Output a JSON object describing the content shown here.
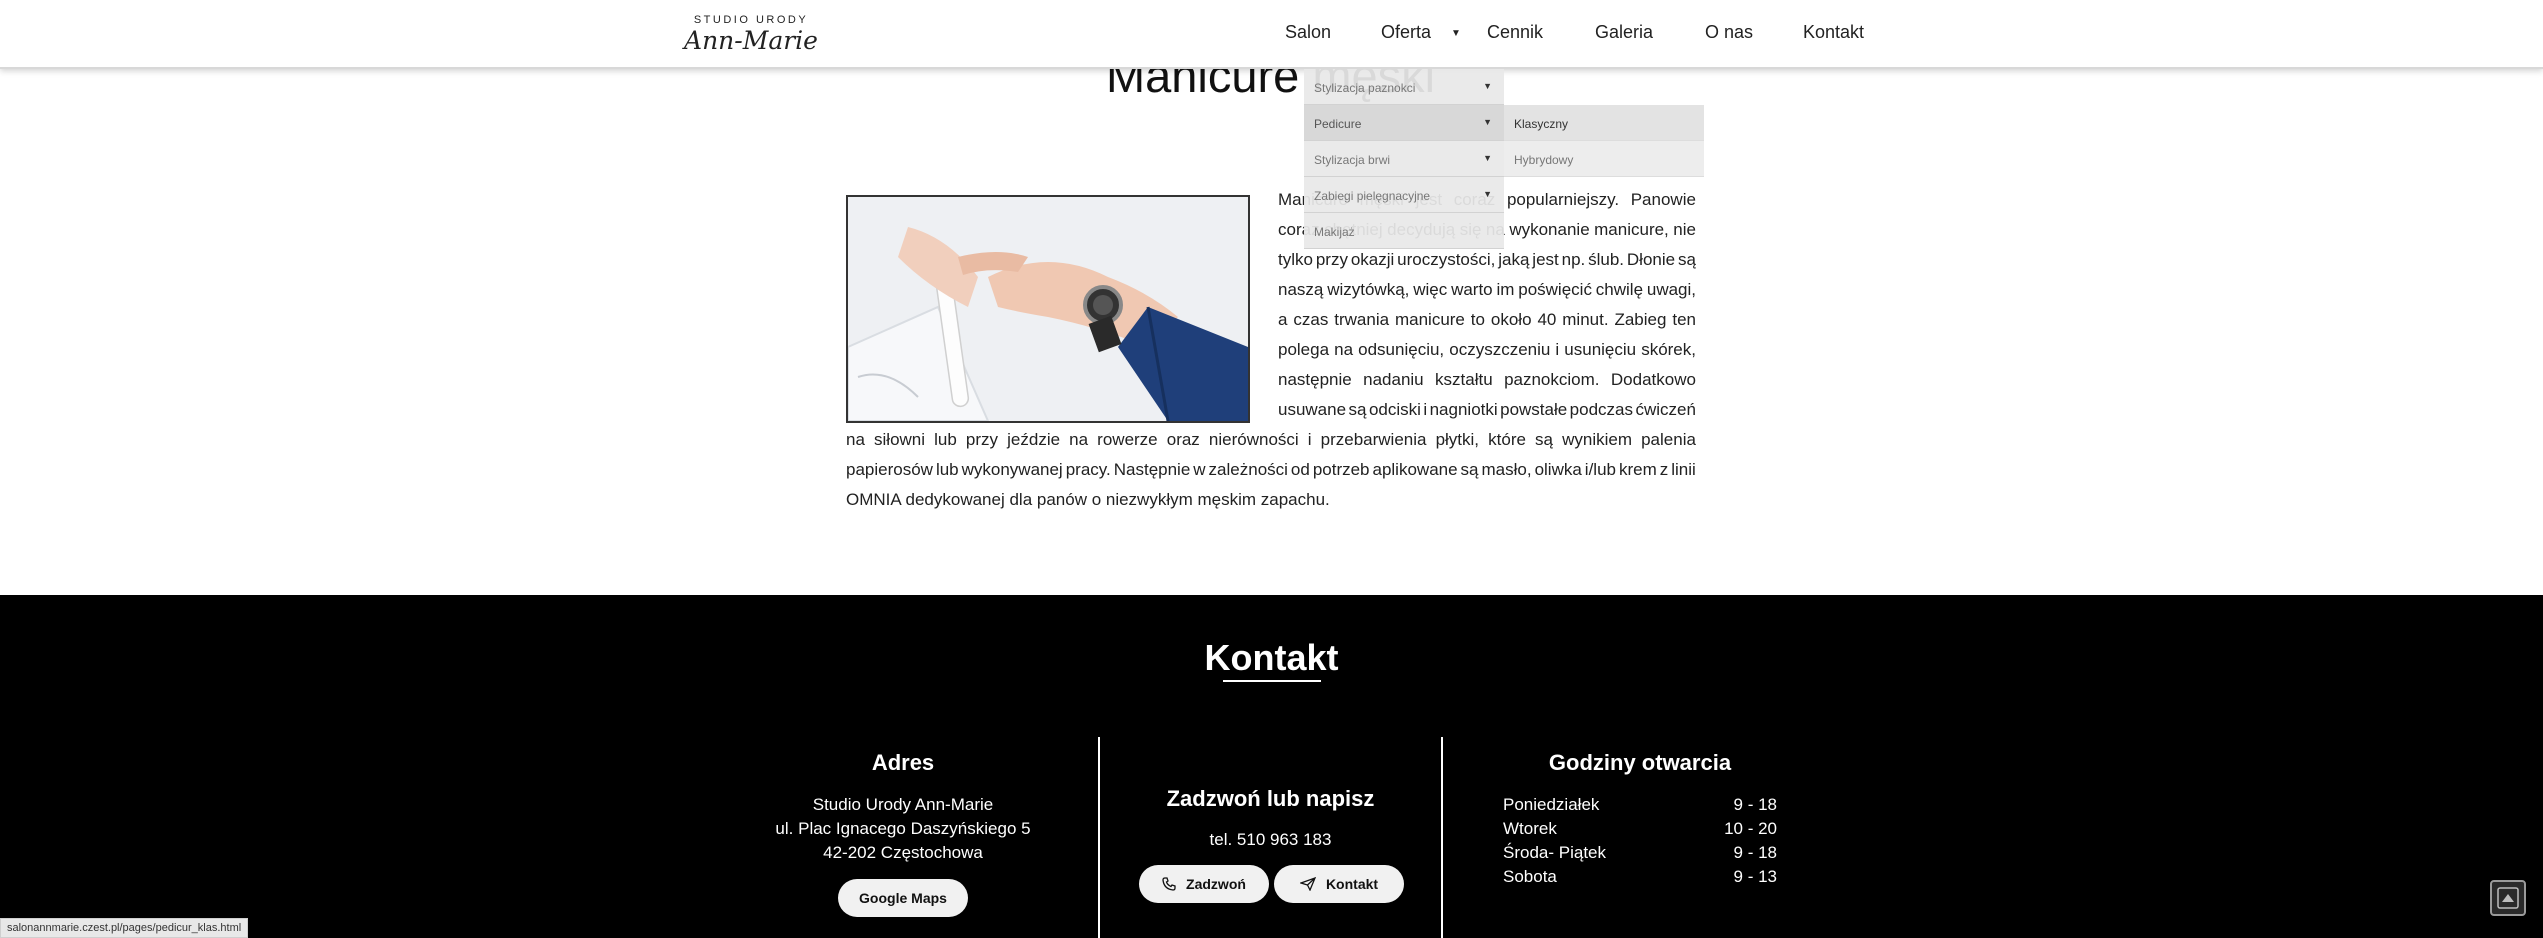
{
  "header": {
    "logo_top": "STUDIO URODY",
    "logo_script": "Ann-Marie",
    "nav": [
      "Salon",
      "Oferta",
      "Cennik",
      "Galeria",
      "O nas",
      "Kontakt"
    ]
  },
  "page_title": "Manicure męski",
  "dropdown": {
    "items": [
      "Stylizacja paznokci",
      "Pedicure",
      "Stylizacja brwi",
      "Zabiegi pielęgnacyjne",
      "Makijaż"
    ],
    "submenu": [
      "Klasyczny",
      "Hybrydowy"
    ]
  },
  "article": {
    "right_lines": [
      "Manicure męski jest coraz popularniejszy. Panowie",
      "coraz chętniej decydują się na wykonanie manicure, nie",
      "tylko przy okazji uroczystości, jaką jest np. ślub. Dłonie są",
      "naszą wizytówką, więc warto im poświęcić chwilę uwagi,",
      "a czas trwania manicure to około 40 minut. Zabieg ten",
      "polega na odsunięciu, oczyszczeniu i usunięciu skórek,",
      "następnie nadaniu kształtu paznokciom. Dodatkowo",
      "usuwane są odciski i nagniotki powstałe podczas ćwiczeń"
    ],
    "full_lines": [
      "na siłowni lub przy jeździe na rowerze oraz nierówności i przebarwienia płytki, które są wynikiem palenia",
      "papierosów lub wykonywanej pracy. Następnie w zależności od potrzeb aplikowane są masło, oliwka i/lub krem z linii"
    ],
    "last_line": "OMNIA dedykowanej dla panów o niezwykłym męskim zapachu."
  },
  "footer": {
    "title": "Kontakt",
    "address": {
      "title": "Adres",
      "lines": [
        "Studio Urody Ann-Marie",
        "ul. Plac Ignacego Daszyńskiego 5",
        "42-202 Częstochowa"
      ],
      "maps_button": "Google Maps"
    },
    "contact": {
      "title": "Zadzwoń lub napisz",
      "phone": "tel. 510 963 183",
      "call_button": "Zadzwoń",
      "contact_button": "Kontakt"
    },
    "hours": {
      "title": "Godziny otwarcia",
      "rows": [
        {
          "day": "Poniedziałek",
          "time": "9 - 18"
        },
        {
          "day": "Wtorek",
          "time": "10 - 20"
        },
        {
          "day": "Środa- Piątek",
          "time": "9 - 18"
        },
        {
          "day": "Sobota",
          "time": "9 - 13"
        }
      ]
    }
  },
  "status_bar": "salonannmarie.czest.pl/pages/pedicur_klas.html",
  "icons": {
    "dropdown_arrow": "▼",
    "phone": "phone-icon",
    "send": "send-icon",
    "scroll_top": "arrow-up-icon"
  }
}
